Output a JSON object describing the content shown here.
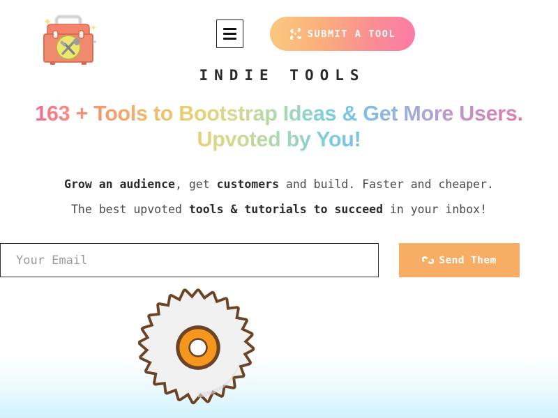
{
  "brand": {
    "name": "INDIE TOOLS",
    "logo_icon": "toolbox-icon"
  },
  "header": {
    "menu_button_icon": "hamburger-menu-icon",
    "submit_button": {
      "label": "SUBMIT A TOOL",
      "icon": "crossed-tools-icon",
      "gradient_from": "#f9c97e",
      "gradient_to": "#fb7aa6"
    }
  },
  "hero": {
    "headline_line1": "163 + Tools to Bootstrap Ideas & Get More Users.",
    "headline_line2": "Upvoted by You!",
    "tool_count": "163 +",
    "headline_gradient_start": "#f4628f",
    "headline_gradient_end": "#ef6b95",
    "subcopy": {
      "line1_part1": "Grow an audience",
      "line1_part2": ", get ",
      "line1_part3": "customers",
      "line1_part4": " and build. Faster and cheaper.",
      "line2_part1": "The best upvoted ",
      "line2_part2": "tools & tutorials to succeed",
      "line2_part3": " in your inbox!"
    }
  },
  "signup": {
    "email_placeholder": "Your Email",
    "email_value": "",
    "send_button_label": "Send Them",
    "send_button_icon": "send-paperplane-icon",
    "send_button_color": "#f7ae64"
  },
  "decoration": {
    "saw_blade_icon": "circular-saw-blade-icon",
    "blade_outline_color": "#6b4426",
    "blade_body_color": "#ececec",
    "blade_hub_color": "#f5961e",
    "bottom_wash_color": "#cef2fc"
  }
}
